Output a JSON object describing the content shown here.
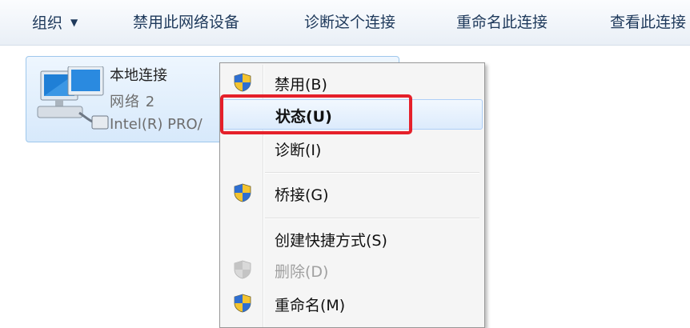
{
  "toolbar": {
    "organize": "组织",
    "disable_device": "禁用此网络设备",
    "diagnose": "诊断这个连接",
    "rename": "重命名此连接",
    "view_status": "查看此连接"
  },
  "adapter": {
    "name": "本地连接",
    "network": "网络  2",
    "device": "Intel(R) PRO/"
  },
  "context_menu": {
    "items": [
      {
        "label": "禁用(B)",
        "icon": "uac-shield-icon",
        "state": "normal"
      },
      {
        "label": "状态(U)",
        "icon": "",
        "state": "default-hovered"
      },
      {
        "label": "诊断(I)",
        "icon": "",
        "state": "normal"
      },
      {
        "label": "桥接(G)",
        "icon": "uac-shield-icon",
        "state": "normal"
      },
      {
        "label": "创建快捷方式(S)",
        "icon": "",
        "state": "normal"
      },
      {
        "label": "删除(D)",
        "icon": "uac-shield-icon",
        "state": "disabled"
      },
      {
        "label": "重命名(M)",
        "icon": "uac-shield-icon",
        "state": "normal"
      }
    ]
  },
  "colors": {
    "highlight_border": "#e5202a",
    "toolbar_text": "#1e395b",
    "selection_border": "#9ec7ec"
  }
}
